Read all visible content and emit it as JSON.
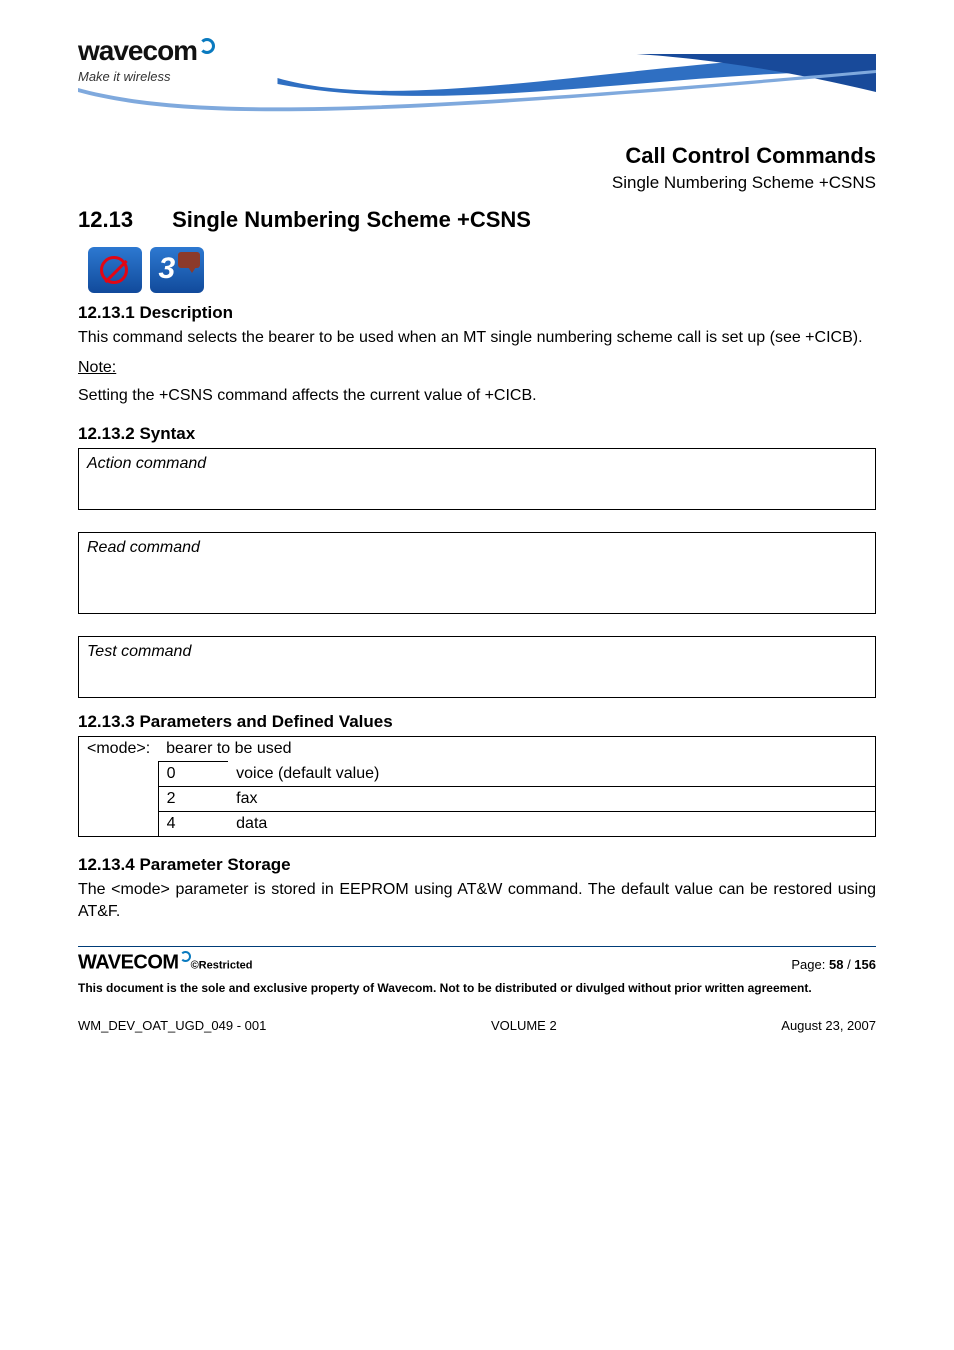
{
  "logo": {
    "brand": "wavecom",
    "tagline": "Make it wireless"
  },
  "breadcrumb": {
    "chapter": "Call Control Commands",
    "section": "Single Numbering Scheme +CSNS"
  },
  "heading": {
    "number": "12.13",
    "title": "Single Numbering Scheme +CSNS"
  },
  "desc": {
    "heading": "12.13.1 Description",
    "text": "This command selects the bearer to be used when an MT single numbering scheme call is set up (see +CICB).",
    "note_label": "Note:",
    "note_text": "Setting the +CSNS command affects the current value of +CICB."
  },
  "syntax": {
    "heading": "12.13.2 Syntax",
    "action_label": "Action command",
    "read_label": "Read command",
    "test_label": "Test command"
  },
  "params": {
    "heading": "12.13.3 Parameters and Defined Values",
    "key": "<mode>:",
    "key_desc": "bearer to be used",
    "rows": [
      {
        "val": "0",
        "text": "voice (default value)"
      },
      {
        "val": "2",
        "text": "fax"
      },
      {
        "val": "4",
        "text": "data"
      }
    ]
  },
  "storage": {
    "heading": "12.13.4 Parameter Storage",
    "text": "The <mode> parameter is stored in EEPROM using AT&W command. The default value can be restored using AT&F."
  },
  "footer": {
    "logo": "WAVECOM",
    "restricted": "©Restricted",
    "page_label": "Page: ",
    "page_current": "58",
    "page_sep": " / ",
    "page_total": "156",
    "disclaimer": "This document is the sole and exclusive property of Wavecom. Not to be distributed or divulged without prior written agreement.",
    "doc_id": "WM_DEV_OAT_UGD_049 - 001",
    "volume": "VOLUME 2",
    "date": "August 23, 2007"
  }
}
